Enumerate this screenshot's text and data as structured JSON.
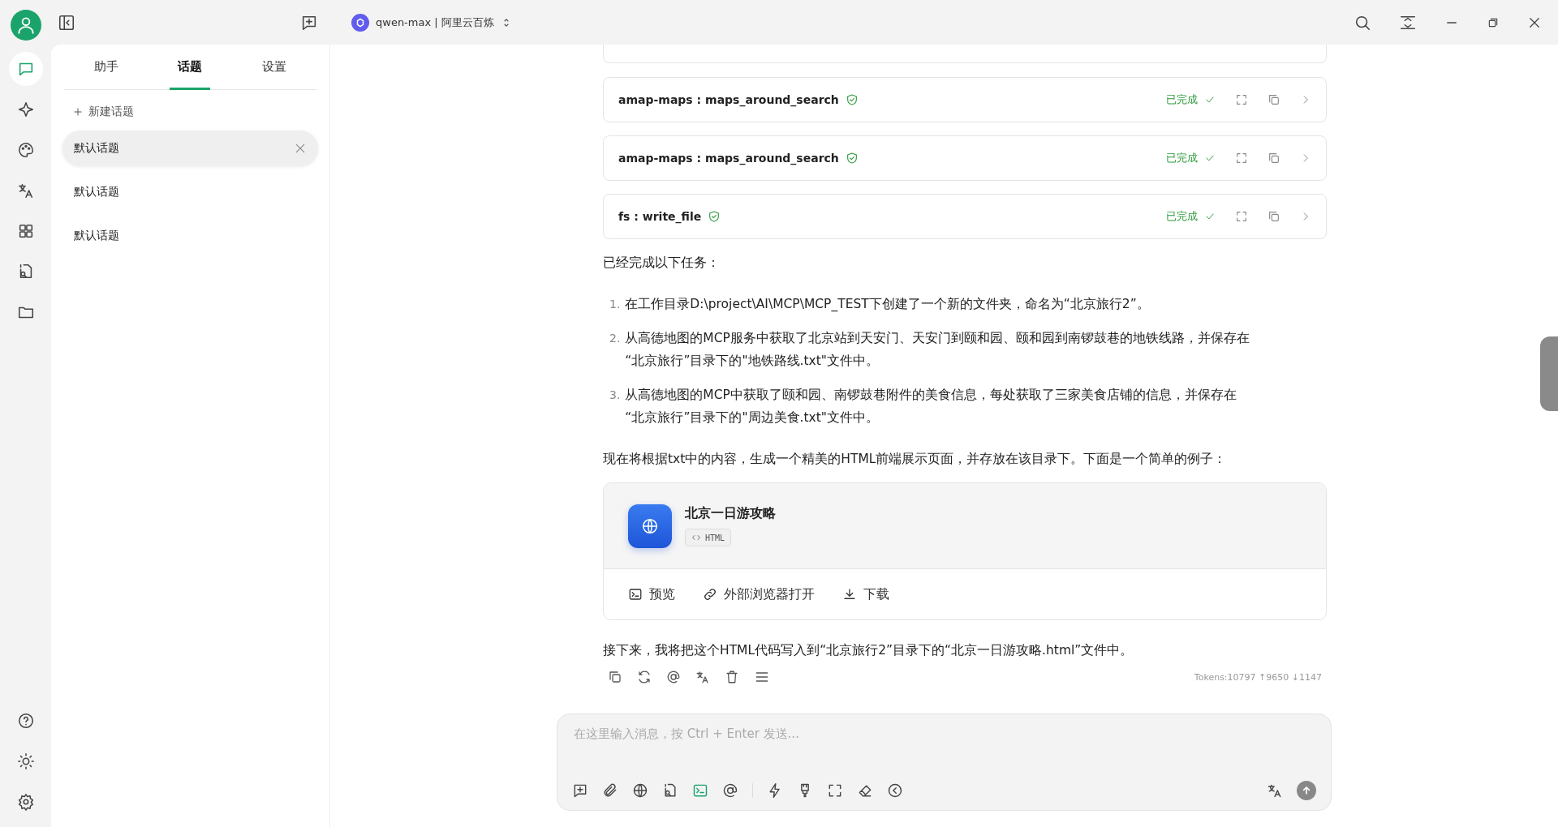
{
  "rail_items": [
    {
      "selected": true
    },
    {
      "selected": false
    },
    {
      "selected": false
    },
    {
      "selected": false
    },
    {
      "selected": false
    },
    {
      "selected": false
    },
    {
      "selected": false
    }
  ],
  "model_selector": {
    "label": "qwen-max | 阿里云百炼"
  },
  "topic_tabs": [
    {
      "label": "助手",
      "selected": false
    },
    {
      "label": "话题",
      "selected": true
    },
    {
      "label": "设置",
      "selected": false
    }
  ],
  "new_topic": {
    "label": "新建话题"
  },
  "topics": [
    {
      "label": "默认话题",
      "selected": true
    },
    {
      "label": "默认话题",
      "selected": false
    },
    {
      "label": "默认话题",
      "selected": false
    }
  ],
  "tool_calls": [
    {
      "name": "amap-maps : maps_around_search",
      "status": "已完成"
    },
    {
      "name": "amap-maps : maps_around_search",
      "status": "已完成"
    },
    {
      "name": "fs : write_file",
      "status": "已完成"
    }
  ],
  "message": {
    "intro": "已经完成以下任务：",
    "list": [
      {
        "number": "1.",
        "lines": [
          "在工作目录D:\\project\\AI\\MCP\\MCP_TEST下创建了一个新的文件夹，命名为“北京旅行2”。"
        ]
      },
      {
        "number": "2.",
        "lines": [
          "从高德地图的MCP服务中获取了北京站到天安门、天安门到颐和园、颐和园到南锣鼓巷的地铁线路，并保存在",
          "“北京旅行”目录下的\"地铁路线.txt\"文件中。"
        ]
      },
      {
        "number": "3.",
        "lines": [
          "从高德地图的MCP中获取了颐和园、南锣鼓巷附件的美食信息，每处获取了三家美食店铺的信息，并保存在",
          "“北京旅行”目录下的\"周边美食.txt\"文件中。"
        ]
      }
    ],
    "outro": "现在将根据txt中的内容，生成一个精美的HTML前端展示页面，并存放在该目录下。下面是一个简单的例子：",
    "artifact": {
      "title": "北京一日游攻略",
      "tag": "HTML",
      "actions": [
        "预览",
        "外部浏览器打开",
        "下载"
      ]
    },
    "closing": "接下来，我将把这个HTML代码写入到“北京旅行2”目录下的“北京一日游攻略.html”文件中。",
    "tokens": "Tokens:10797 ↑9650 ↓1147"
  },
  "input": {
    "placeholder": "在这里输入消息，按 Ctrl + Enter 发送..."
  }
}
